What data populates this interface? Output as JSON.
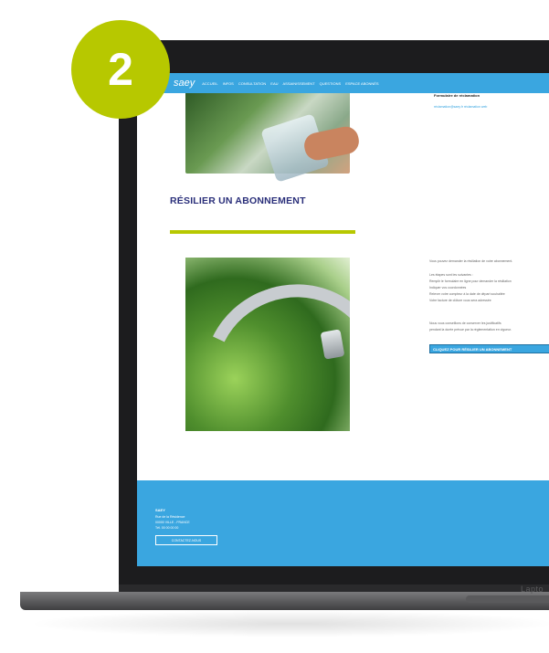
{
  "badge": {
    "number": "2"
  },
  "device": {
    "label": "Lapto"
  },
  "site": {
    "brand": "saey",
    "nav": [
      "ACCUEIL",
      "INFOS",
      "CONSULTATION",
      "EAU",
      "ASSAINISSEMENT",
      "QUESTIONS",
      "ESPACE ABONNÉS"
    ]
  },
  "form_block": {
    "title": "Formulaire de réclamation",
    "line": "réclamation@saey.fr réclamation web"
  },
  "section": {
    "title": "RÉSILIER UN ABONNEMENT"
  },
  "paragraphs": [
    "Vous pouvez demander la résiliation de votre abonnement.",
    "Les étapes sont les suivantes :",
    "Remplir le formulaire en ligne pour demander la résiliation",
    "Indiquer vos coordonnées",
    "Relever votre compteur à la date de départ souhaitée",
    "Votre facture de clôture vous sera adressée",
    "Nous vous conseillons de conserver les justificatifs",
    "pendant la durée prévue par la réglementation en vigueur."
  ],
  "cta": {
    "label": "CLIQUEZ POUR RÉSILIER UN ABONNEMENT"
  },
  "footer": {
    "name": "SAEY",
    "lines": [
      "Rue de la Résidence",
      "00000 VILLE - FRANCE",
      "Tél. 00 00 00 00"
    ],
    "button": "CONTACTEZ-NOUS"
  },
  "colors": {
    "badge": "#b7c800",
    "brand_blue": "#3aa6e0",
    "title_navy": "#2a2f7a",
    "rule_green": "#b7c800"
  }
}
